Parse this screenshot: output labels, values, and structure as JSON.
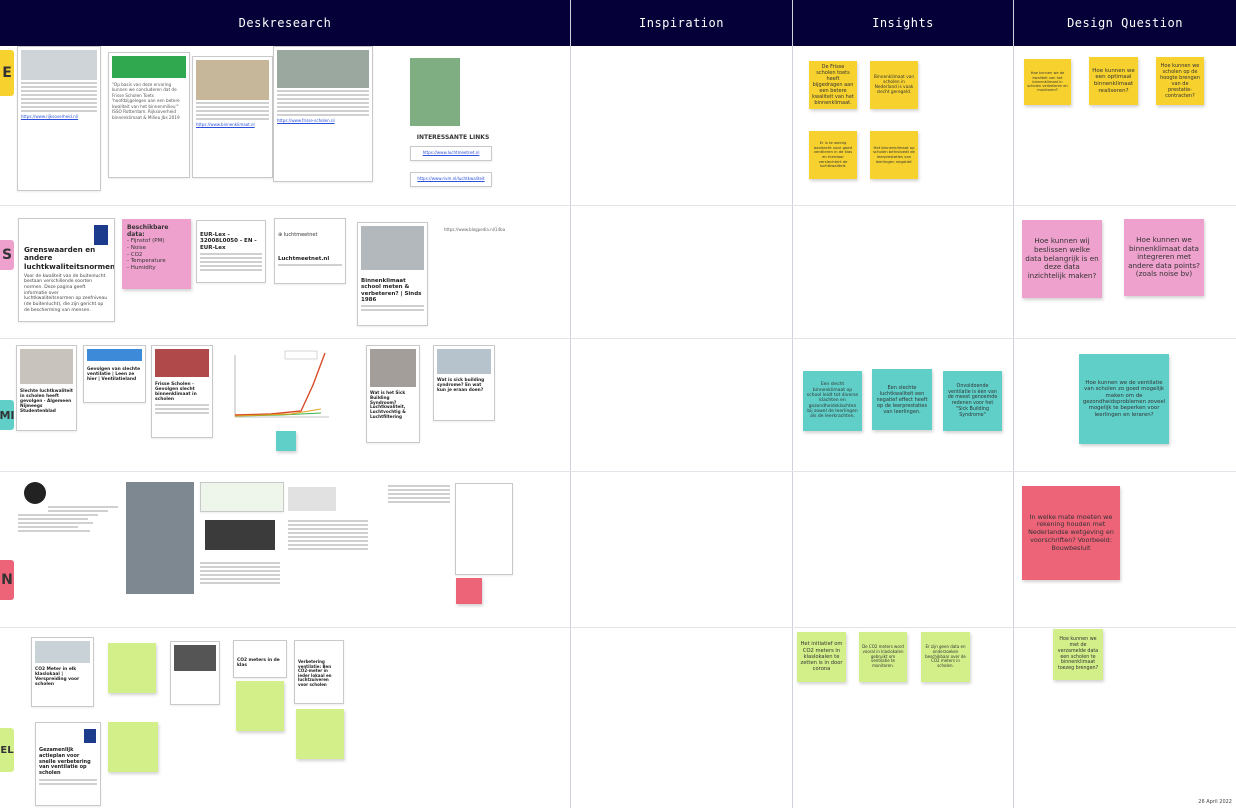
{
  "headers": {
    "deskresearch": "Deskresearch",
    "inspiration": "Inspiration",
    "insights": "Insights",
    "design_question": "Design Question"
  },
  "row_tags": {
    "r1": "E",
    "r2": "S",
    "r3": "MI",
    "r4": "N",
    "r5": "EL"
  },
  "desk": {
    "quote_card": "\"Op basis van deze ervaring kunnen we concluderen dat de Frisse Scholen Toets 'hoofdzijgelegen aan een betere kwaliteit van het binnenmilieu'\" ISSO Rotterdam. Rijksoverheid binnenklimaat & Milieu Jbs 2019",
    "interesting_links": "INTERESSANTE LINKS",
    "luchtmeetnet_title": "Luchtmeetnet.nl",
    "grenswaarden_title": "Grenswaarden en andere luchtkwaliteitsnormen",
    "grenswaarden_body": "Voor de kwaliteit van de buitenlucht bestaan verschillende soorten normen. Deze pagina geeft informatie over luchtkwaliteitsnormen op zeefniveau (de buitenlucht), die zijn gericht op de bescherming van mensen.",
    "beschikbare_title": "Beschikbare data:",
    "beschikbare_items": [
      "- Fijnstof (PM)",
      "- Noise",
      "- CO2",
      "- Temperature",
      "- Humidity"
    ],
    "eurlex_title": "EUR-Lex - 32008L0050 - EN - EUR-Lex",
    "binnenklimaat_title": "Binnenklimaat school meten & verbeteren? | Sinds 1986",
    "url_text": "https://www.blogpedia.nl/14ba",
    "slechte_title": "Slechte luchtkwaliteit in scholen heeft gevolgen - Algemeen Nijmeegs Studentenblad",
    "gevolgen_title": "Gevolgen van slechte ventilatie | Leen ze hier | Ventilatieland",
    "frisse_title": "Frisse Scholen - Gevolgen slecht binnenklimaat in scholen",
    "sbs_title": "Wat is het Sick Building Syndroom? Luchtkwaliteit, Luchtvochtig & Luchtfiltering",
    "intensa_title": "Wat is sick building syndrome? En wat kun je eraan doen?",
    "co2_title": "CO2 Meter in elk klaslokaal | Verspreiding voor scholen",
    "gezamenlijk_title": "Gezamenlijk actieplan voor snelle verbetering van ventilatie op scholen",
    "co2meters_title": "CO2 meters in de klas",
    "verbetering_title": "Verbetering ventilatie: Ben CO2-meter in ieder lokaal en luchtzuiveren voor scholen"
  },
  "insights": {
    "row1": [
      "De Frisse scholen toets heeft bijgedragen aan een betere kwaliteit van het binnenklimaat.",
      "Binnenklimaat van scholen in Nederland is vaak slecht geregeld.",
      "Er is te weinig aandacht voor goed ventileren in de klas en hierdoor verslechtert de luchtkwaliteit.",
      "Het binnenklimaat op scholen beïnvloedt de leerprestaties van leerlingen negatief."
    ],
    "row3": [
      "Een slecht binnenklimaat op school leidt tot diverse klachten en gezondheidsklachten bij zowel de leerlingen als de leerkrachten.",
      "Een slechte luchtkwaliteit een negatief effect heeft op de leerprestaties van leerlingen.",
      "Onvoldoende ventilatie is één van de meest genoemde redenen voor het \"Sick Building Syndrome\""
    ],
    "row5": [
      "Het initiatief om CO2 meters in klaslokalen te zetten is in door corona",
      "De CO2 meters word vooral in klaslokalen gebruikt om ventilatie te monitoren.",
      "Er zijn geen data en onderzoeken beschikbaar over de CO2 meters in scholen."
    ]
  },
  "design_questions": {
    "row1": [
      "Hoe kunnen we de kwaliteit van het binnenklimaat in scholen verbeteren en monitoren?",
      "Hoe kunnen we een optimaal binnenklimaat realiseren?",
      "Hoe kunnen we scholen op de hoogte brengen van de prestatie-contracten?"
    ],
    "row2": [
      "Hoe kunnen wij beslissen welke data belangrijk is en deze data inzichtelijk maken?",
      "Hoe kunnen we binnenklimaat data integreren met andere data points? (zoals noise bv)"
    ],
    "row3": "Hoe kunnen we de ventilatie van scholen zo goed mogelijk maken om de gezondheidsproblemen zoveel mogelijk te beperken voor leerlingen en leraren?",
    "row4": "In welke mate moeten we rekening houden met Nederlandse wetgeving en voorschriften? Voorbeeld: Bouwbesluit",
    "row5": "Hoe kunnen we met de verzamelde data een scholen te binnenklimaat toezeg brengen?"
  },
  "date": "26 April 2022"
}
